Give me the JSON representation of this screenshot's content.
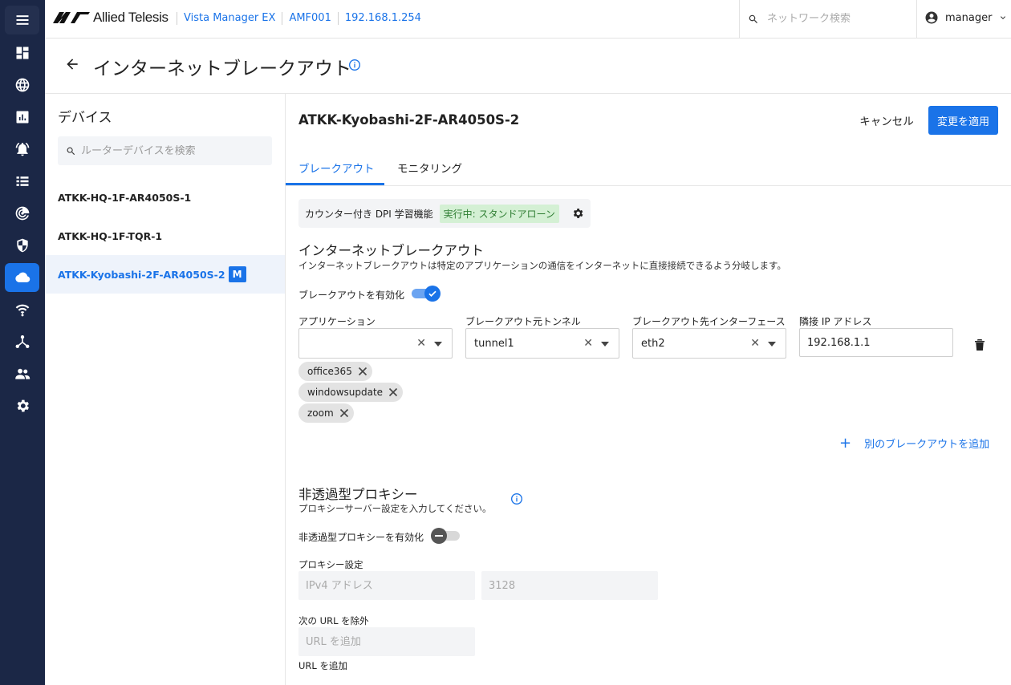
{
  "header": {
    "brand": "Allied Telesis",
    "crumbs": [
      "Vista Manager EX",
      "AMF001",
      "192.168.1.254"
    ],
    "search_placeholder": "ネットワーク検索",
    "user": "manager"
  },
  "page": {
    "title": "インターネットブレークアウト"
  },
  "devices": {
    "heading": "デバイス",
    "search_placeholder": "ルーターデバイスを検索",
    "items": [
      {
        "name": "ATKK-HQ-1F-AR4050S-1"
      },
      {
        "name": "ATKK-HQ-1F-TQR-1"
      },
      {
        "name": "ATKK-Kyobashi-2F-AR4050S-2",
        "badge": "M"
      }
    ]
  },
  "main": {
    "device_title": "ATKK-Kyobashi-2F-AR4050S-2",
    "cancel": "キャンセル",
    "apply": "変更を適用",
    "tabs": [
      {
        "label": "ブレークアウト"
      },
      {
        "label": "モニタリング"
      }
    ],
    "dpi": {
      "label": "カウンター付き DPI 学習機能",
      "status": "実行中: スタンドアローン"
    },
    "breakout": {
      "title": "インターネットブレークアウト",
      "desc": "インターネットブレークアウトは特定のアプリケーションの通信をインターネットに直接接続できるよう分岐します。",
      "enable_label": "ブレークアウトを有効化",
      "enabled": true,
      "columns": {
        "application": "アプリケーション",
        "tunnel": "ブレークアウト元トンネル",
        "interface": "ブレークアウト先インターフェース",
        "neighbor_ip": "隣接 IP アドレス"
      },
      "tunnel_value": "tunnel1",
      "interface_value": "eth2",
      "ip_value": "192.168.1.1",
      "chips": [
        "office365",
        "windowsupdate",
        "zoom"
      ],
      "add_label": "別のブレークアウトを追加"
    },
    "proxy": {
      "title": "非透過型プロキシー",
      "desc": "プロキシーサーバー設定を入力してください。",
      "enable_label": "非透過型プロキシーを有効化",
      "enabled": false,
      "settings_label": "プロキシー設定",
      "ipv4_placeholder": "IPv4 アドレス",
      "port_placeholder": "3128",
      "exclude_label": "次の URL を除外",
      "url_placeholder": "URL を追加",
      "url_hint": "URL を追加"
    }
  },
  "colors": {
    "rail": "#1b2746",
    "accent": "#1a73e8",
    "running_badge_bg": "#d4f0d4",
    "running_badge_fg": "#2e7d32"
  }
}
